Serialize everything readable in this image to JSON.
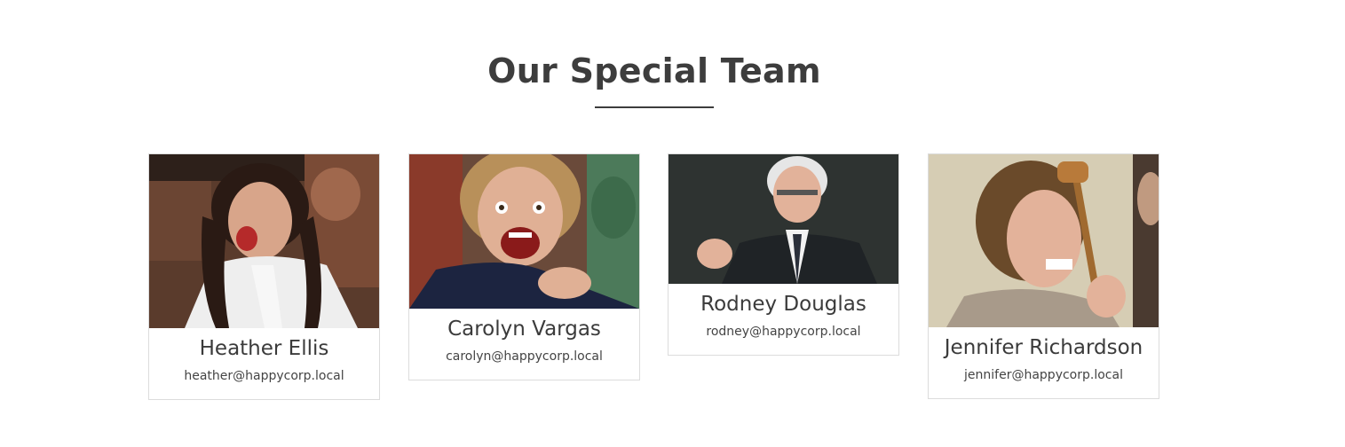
{
  "section": {
    "title": "Our Special Team"
  },
  "team": [
    {
      "name": "Heather Ellis",
      "email": "heather@happycorp.local",
      "photo_icon": "portrait-photo"
    },
    {
      "name": "Carolyn Vargas",
      "email": "carolyn@happycorp.local",
      "photo_icon": "portrait-photo"
    },
    {
      "name": "Rodney Douglas",
      "email": "rodney@happycorp.local",
      "photo_icon": "portrait-photo"
    },
    {
      "name": "Jennifer Richardson",
      "email": "jennifer@happycorp.local",
      "photo_icon": "portrait-photo"
    }
  ]
}
